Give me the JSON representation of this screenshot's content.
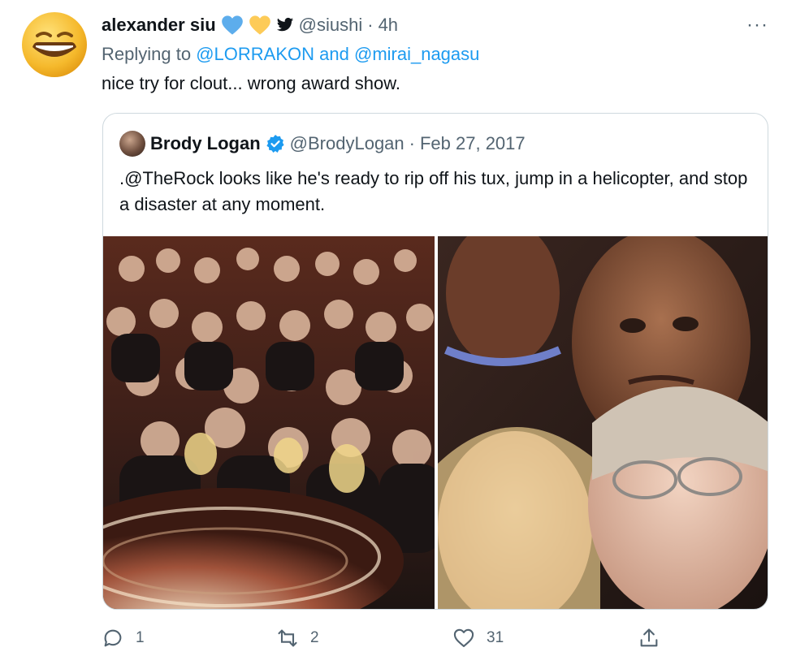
{
  "tweet": {
    "author_name": "alexander siu",
    "author_emojis": [
      "blue-heart",
      "yellow-heart",
      "bird"
    ],
    "handle": "@siushi",
    "separator": "·",
    "time": "4h",
    "more_label": "···",
    "reply_prefix": "Replying to",
    "reply_to": "@LORRAKON",
    "reply_joiner": "and",
    "reply_to_2": "@mirai_nagasu",
    "text": "nice try for clout... wrong award show."
  },
  "quote": {
    "author_name": "Brody Logan",
    "handle": "@BrodyLogan",
    "separator": "·",
    "date": "Feb 27, 2017",
    "text": ".@TheRock looks like he's ready to rip off his tux, jump in a helicopter, and stop a disaster at any moment."
  },
  "actions": {
    "reply_count": "1",
    "retweet_count": "2",
    "like_count": "31"
  },
  "colors": {
    "link": "#1d9bf0",
    "secondary_text": "#536471",
    "primary_text": "#0f1419",
    "border": "#cfd9de"
  }
}
